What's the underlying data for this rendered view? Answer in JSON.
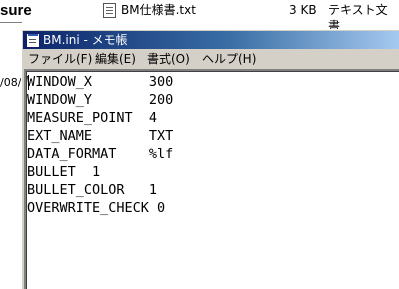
{
  "background_window": {
    "heading_fragment": "sure",
    "date_fragment": "/08/",
    "file_row": {
      "name": "BM仕様書.txt",
      "size": "3 KB",
      "type": "テキスト文書",
      "icon": "text-file-icon"
    }
  },
  "notepad": {
    "title": "BM.ini - メモ帳",
    "title_icon": "notepad-icon",
    "menu": [
      {
        "label": "ファイル(F)"
      },
      {
        "label": "編集(E)"
      },
      {
        "label": "書式(O)"
      },
      {
        "label": "ヘルプ(H)"
      }
    ],
    "lines": [
      "WINDOW_X       300",
      "WINDOW_Y       200",
      "MEASURE_POINT  4",
      "EXT_NAME       TXT",
      "DATA_FORMAT    %lf",
      "BULLET  1",
      "BULLET_COLOR   1",
      "OVERWRITE_CHECK 0"
    ]
  },
  "colors": {
    "titlebar_start": "#0a246a",
    "titlebar_end": "#a6caf0",
    "window_face": "#d4d0c8"
  }
}
